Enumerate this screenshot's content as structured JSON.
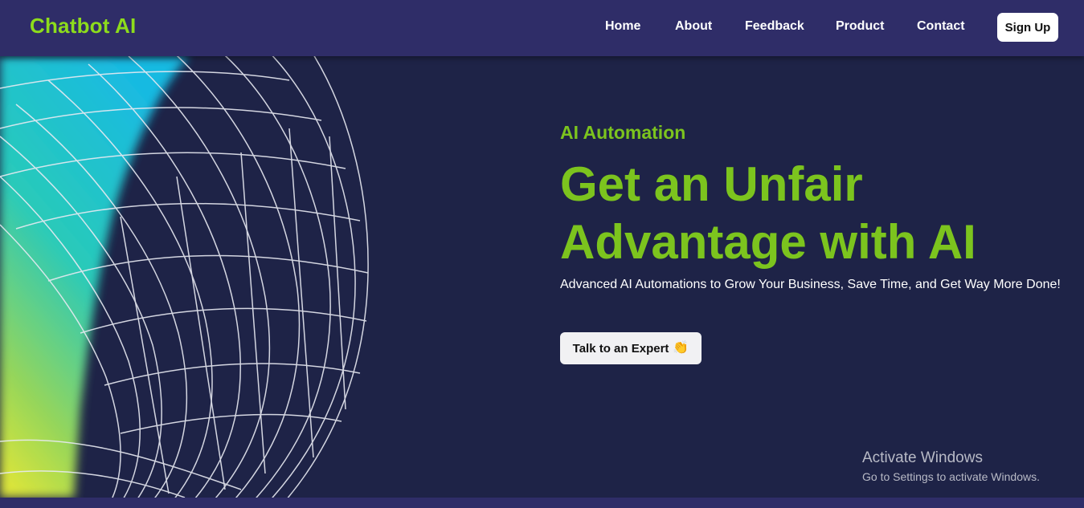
{
  "nav": {
    "brand": "Chatbot AI",
    "links": [
      {
        "label": "Home"
      },
      {
        "label": "About"
      },
      {
        "label": "Feedback"
      },
      {
        "label": "Product"
      },
      {
        "label": "Contact"
      }
    ],
    "signup_label": "Sign Up"
  },
  "hero": {
    "eyebrow": "AI Automation",
    "headline_line1": "Get an Unfair",
    "headline_line2": "Advantage with AI",
    "subtext": "Advanced AI Automations to Grow Your Business, Save Time, and Get Way More Done!",
    "cta_label": "Talk to an Expert",
    "cta_icon": "👏",
    "art_icon": "wireframe-globe-gradient"
  },
  "watermark": {
    "title": "Activate Windows",
    "subtitle": "Go to Settings to activate Windows."
  },
  "colors": {
    "nav_bg": "#2f2d68",
    "hero_bg": "#1e2347",
    "accent_green": "#7cc41e",
    "brand_green": "#8ddc1c"
  }
}
